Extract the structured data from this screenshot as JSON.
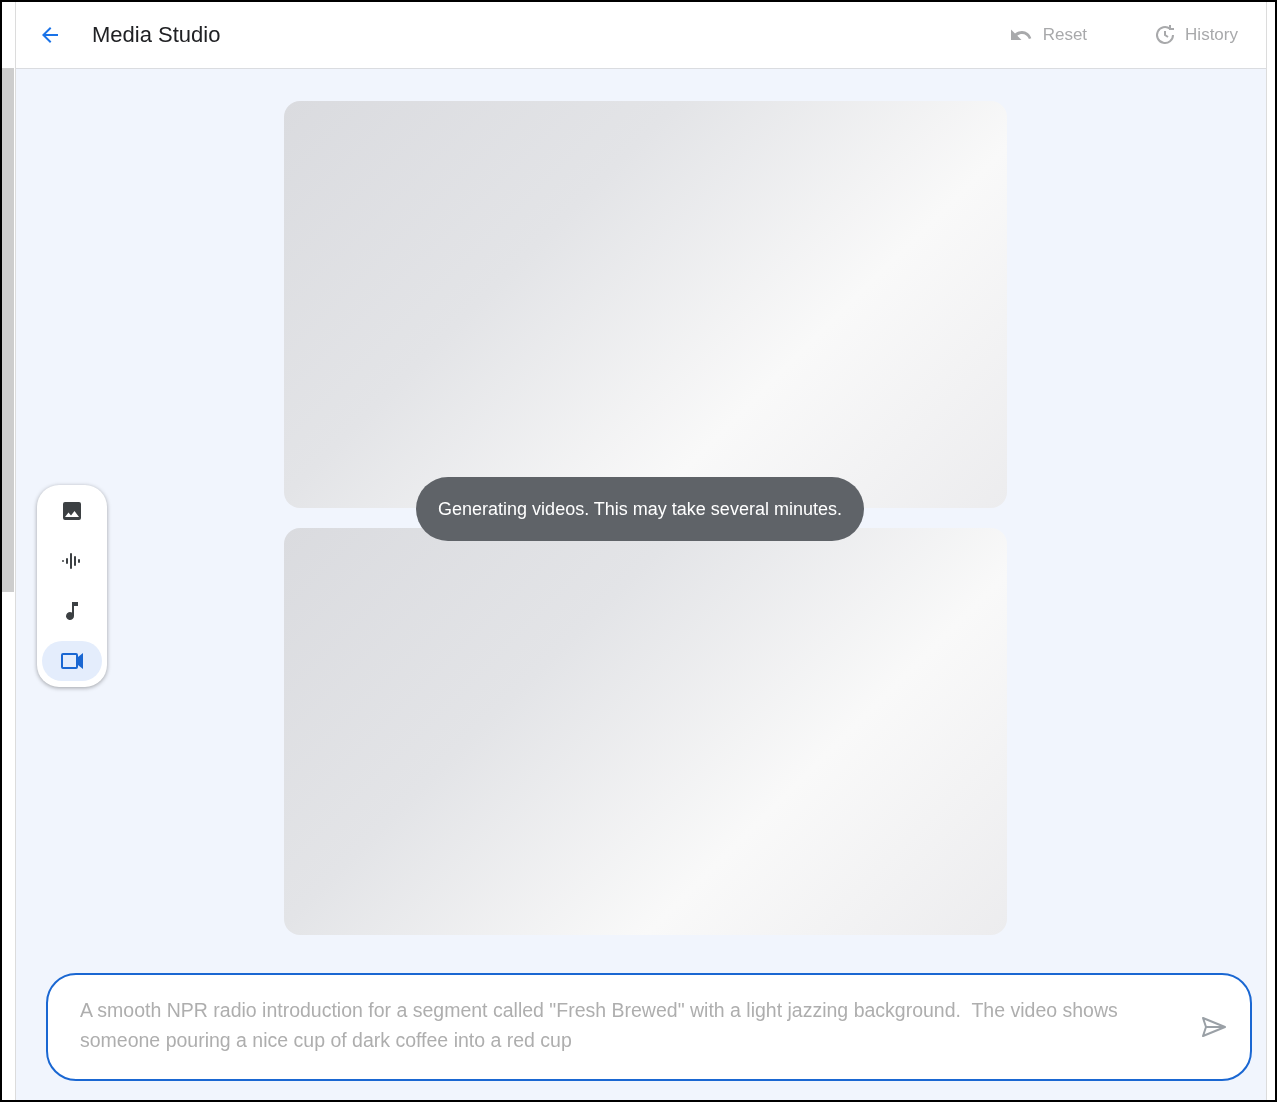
{
  "header": {
    "title": "Media Studio",
    "actions": [
      {
        "label": "Reset",
        "kind": "reset",
        "disabled": true
      },
      {
        "label": "History",
        "kind": "history",
        "disabled": true
      }
    ]
  },
  "tools": [
    {
      "kind": "image",
      "selected": false
    },
    {
      "kind": "speech",
      "selected": false
    },
    {
      "kind": "music",
      "selected": false
    },
    {
      "kind": "video",
      "selected": true
    }
  ],
  "video_slots": [
    {
      "loading": true
    },
    {
      "loading": true
    }
  ],
  "toast": {
    "text": "Generating videos. This may take several minutes."
  },
  "prompt": {
    "value": "A smooth NPR radio introduction for a segment called \"Fresh Brewed\" with a light jazzing background.  The video shows someone pouring a nice cup of dark coffee into a red cup",
    "disabled": true
  }
}
